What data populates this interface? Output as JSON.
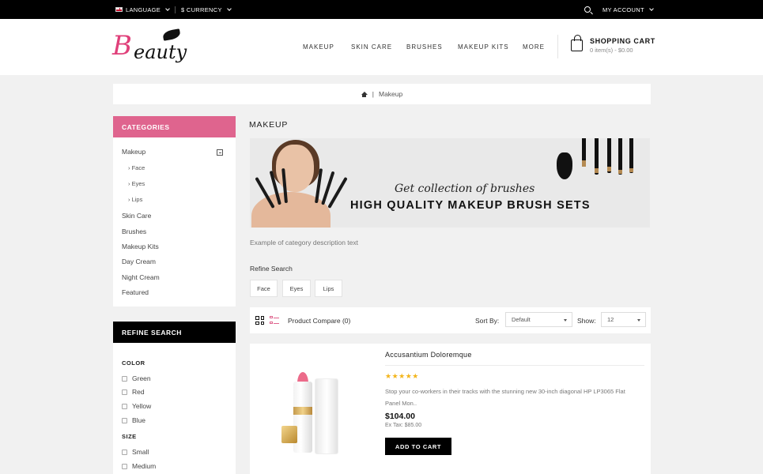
{
  "topbar": {
    "language": "LANGUAGE",
    "currency": "$ CURRENCY",
    "account": "MY ACCOUNT"
  },
  "header": {
    "logo_initial": "B",
    "logo_rest": "eauty",
    "nav": [
      "MAKEUP",
      "SKIN CARE",
      "BRUSHES",
      "MAKEUP KITS",
      "MORE"
    ],
    "cart_title": "SHOPPING CART",
    "cart_summary": "0 item(s) - $0.00"
  },
  "breadcrumb": {
    "separator": "|",
    "current": "Makeup"
  },
  "sidebar": {
    "categories_title": "CATEGORIES",
    "categories": [
      "Makeup",
      "Skin Care",
      "Brushes",
      "Makeup Kits",
      "Day Cream",
      "Night Cream",
      "Featured"
    ],
    "subcategories": [
      "Face",
      "Eyes",
      "Lips"
    ],
    "refine_title": "REFINE SEARCH",
    "color_label": "COLOR",
    "colors": [
      "Green",
      "Red",
      "Yellow",
      "Blue"
    ],
    "size_label": "SIZE",
    "sizes": [
      "Small",
      "Medium"
    ]
  },
  "main": {
    "title": "MAKEUP",
    "banner_script": "Get collection of brushes",
    "banner_headline": "HIGH QUALITY MAKEUP BRUSH SETS",
    "description": "Example of category description text",
    "refine_label": "Refine Search",
    "tags": [
      "Face",
      "Eyes",
      "Lips"
    ],
    "compare": "Product Compare (0)",
    "sort_label": "Sort By:",
    "sort_value": "Default",
    "show_label": "Show:",
    "show_value": "12"
  },
  "product": {
    "name": "Accusantium Doloremque",
    "rating": 5,
    "stars": "★★★★★",
    "description": "Stop your co-workers in their tracks with the stunning new 30-inch diagonal HP LP3065 Flat Panel Mon..",
    "price": "$104.00",
    "ex_tax": "Ex Tax: $85.00",
    "add_to_cart": "ADD TO CART"
  },
  "colors": {
    "accent_pink": "#df648e",
    "black": "#000000",
    "background": "#f1f1f1",
    "star": "#f3b51c"
  }
}
